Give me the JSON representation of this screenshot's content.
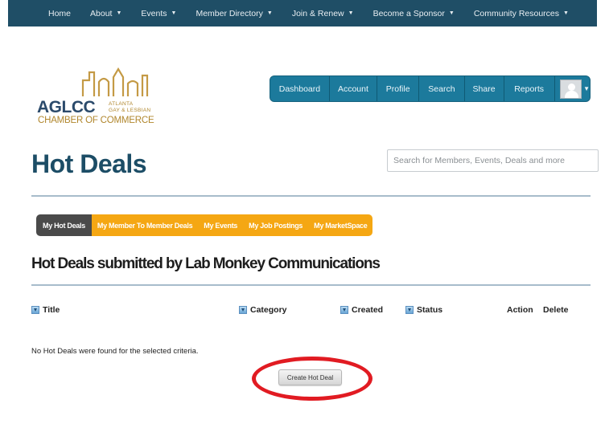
{
  "topnav": {
    "items": [
      "Home",
      "About",
      "Events",
      "Member Directory",
      "Join & Renew",
      "Become a Sponsor",
      "Community Resources"
    ],
    "dropdown": [
      false,
      true,
      true,
      true,
      true,
      true,
      true
    ]
  },
  "logo": {
    "acronym": "AGLCC",
    "line1": "ATLANTA",
    "line2": "GAY & LESBIAN",
    "tagline": "CHAMBER OF COMMERCE"
  },
  "actions": [
    "Dashboard",
    "Account",
    "Profile",
    "Search",
    "Share",
    "Reports"
  ],
  "page": {
    "title": "Hot Deals",
    "search_placeholder": "Search for Members, Events, Deals and more"
  },
  "tabs": [
    "My Hot Deals",
    "My Member To Member Deals",
    "My Events",
    "My Job Postings",
    "My MarketSpace"
  ],
  "section_title": "Hot Deals submitted by Lab Monkey Communications",
  "table": {
    "columns": [
      "Title",
      "Category",
      "Created",
      "Status",
      "Action",
      "Delete"
    ],
    "empty_message": "No Hot Deals were found for the selected criteria."
  },
  "create_button": "Create Hot Deal",
  "colors": {
    "nav_bg": "#1f4e66",
    "action_bar": "#1c7a9c",
    "tab_orange": "#f5a713",
    "tab_active": "#4a4a4a",
    "title_blue": "#1c4d66",
    "highlight_red": "#e11b22"
  }
}
